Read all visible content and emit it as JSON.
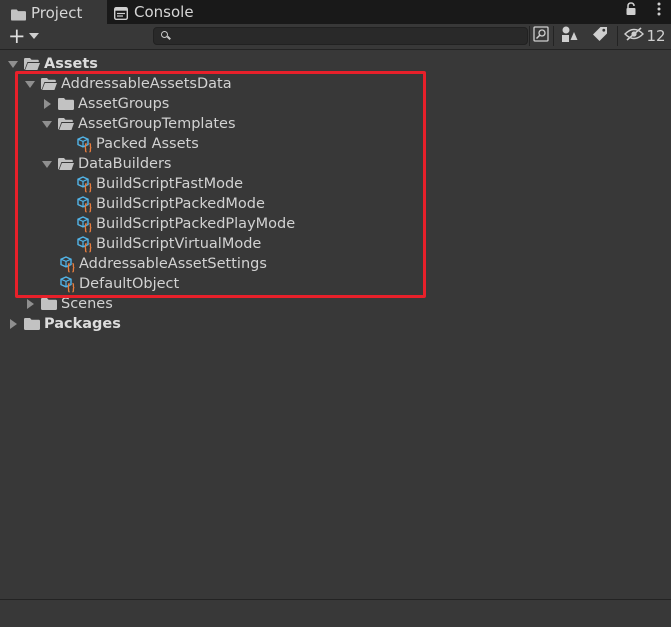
{
  "tabs": {
    "project": "Project",
    "console": "Console"
  },
  "toolbar": {
    "add_label": "+",
    "search_placeholder": "",
    "hidden_count": "12"
  },
  "tree": {
    "assets": "Assets",
    "addressable_assets_data": "AddressableAssetsData",
    "asset_groups": "AssetGroups",
    "asset_group_templates": "AssetGroupTemplates",
    "packed_assets": "Packed Assets",
    "data_builders": "DataBuilders",
    "build_fast": "BuildScriptFastMode",
    "build_packed": "BuildScriptPackedMode",
    "build_packed_play": "BuildScriptPackedPlayMode",
    "build_virtual": "BuildScriptVirtualMode",
    "addressable_settings": "AddressableAssetSettings",
    "default_object": "DefaultObject",
    "scenes": "Scenes",
    "packages": "Packages"
  },
  "colors": {
    "highlight": "#e8202a",
    "so_icon_blue": "#52b4e8",
    "so_icon_orange": "#e87d3e"
  }
}
